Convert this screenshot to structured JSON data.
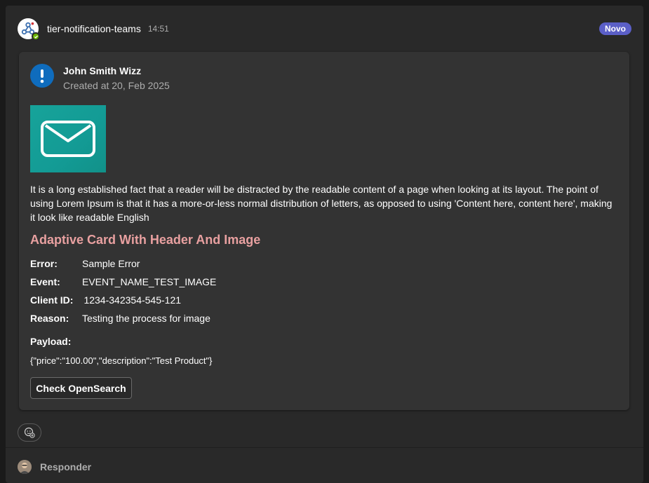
{
  "message": {
    "sender": "tier-notification-teams",
    "time": "14:51",
    "badge": "Novo",
    "bot_avatar_icon": "webhook-icon",
    "status_color": "#6bb700"
  },
  "card": {
    "author": "John Smith Wizz",
    "created": "Created at 20, Feb 2025",
    "header_icon": "alert-exclamation-icon",
    "image_icon": "envelope-icon",
    "body": "It is a long established fact that a reader will be distracted by the readable content of a page when looking at its layout. The point of using Lorem Ipsum is that it has a more-or-less normal distribution of letters, as opposed to using 'Content here, content here', making it look like readable English",
    "title": "Adaptive Card With Header And Image",
    "title_color": "#e8a0a0",
    "facts": [
      {
        "key": "Error:",
        "value": "Sample Error"
      },
      {
        "key": "Event:",
        "value": "EVENT_NAME_TEST_IMAGE"
      },
      {
        "key": "Client ID:",
        "value": "1234-342354-545-121"
      },
      {
        "key": "Reason:",
        "value": "Testing the process for image"
      }
    ],
    "payload_label": "Payload:",
    "payload": "{\"price\":\"100.00\",\"description\":\"Test Product\"}",
    "action_label": "Check OpenSearch"
  },
  "reactions": {
    "icon": "add-reaction-icon"
  },
  "reply": {
    "label": "Responder"
  },
  "colors": {
    "badge": "#5b5fc7",
    "accent_blue": "#0f6cbd",
    "hero": "#17a39a"
  }
}
